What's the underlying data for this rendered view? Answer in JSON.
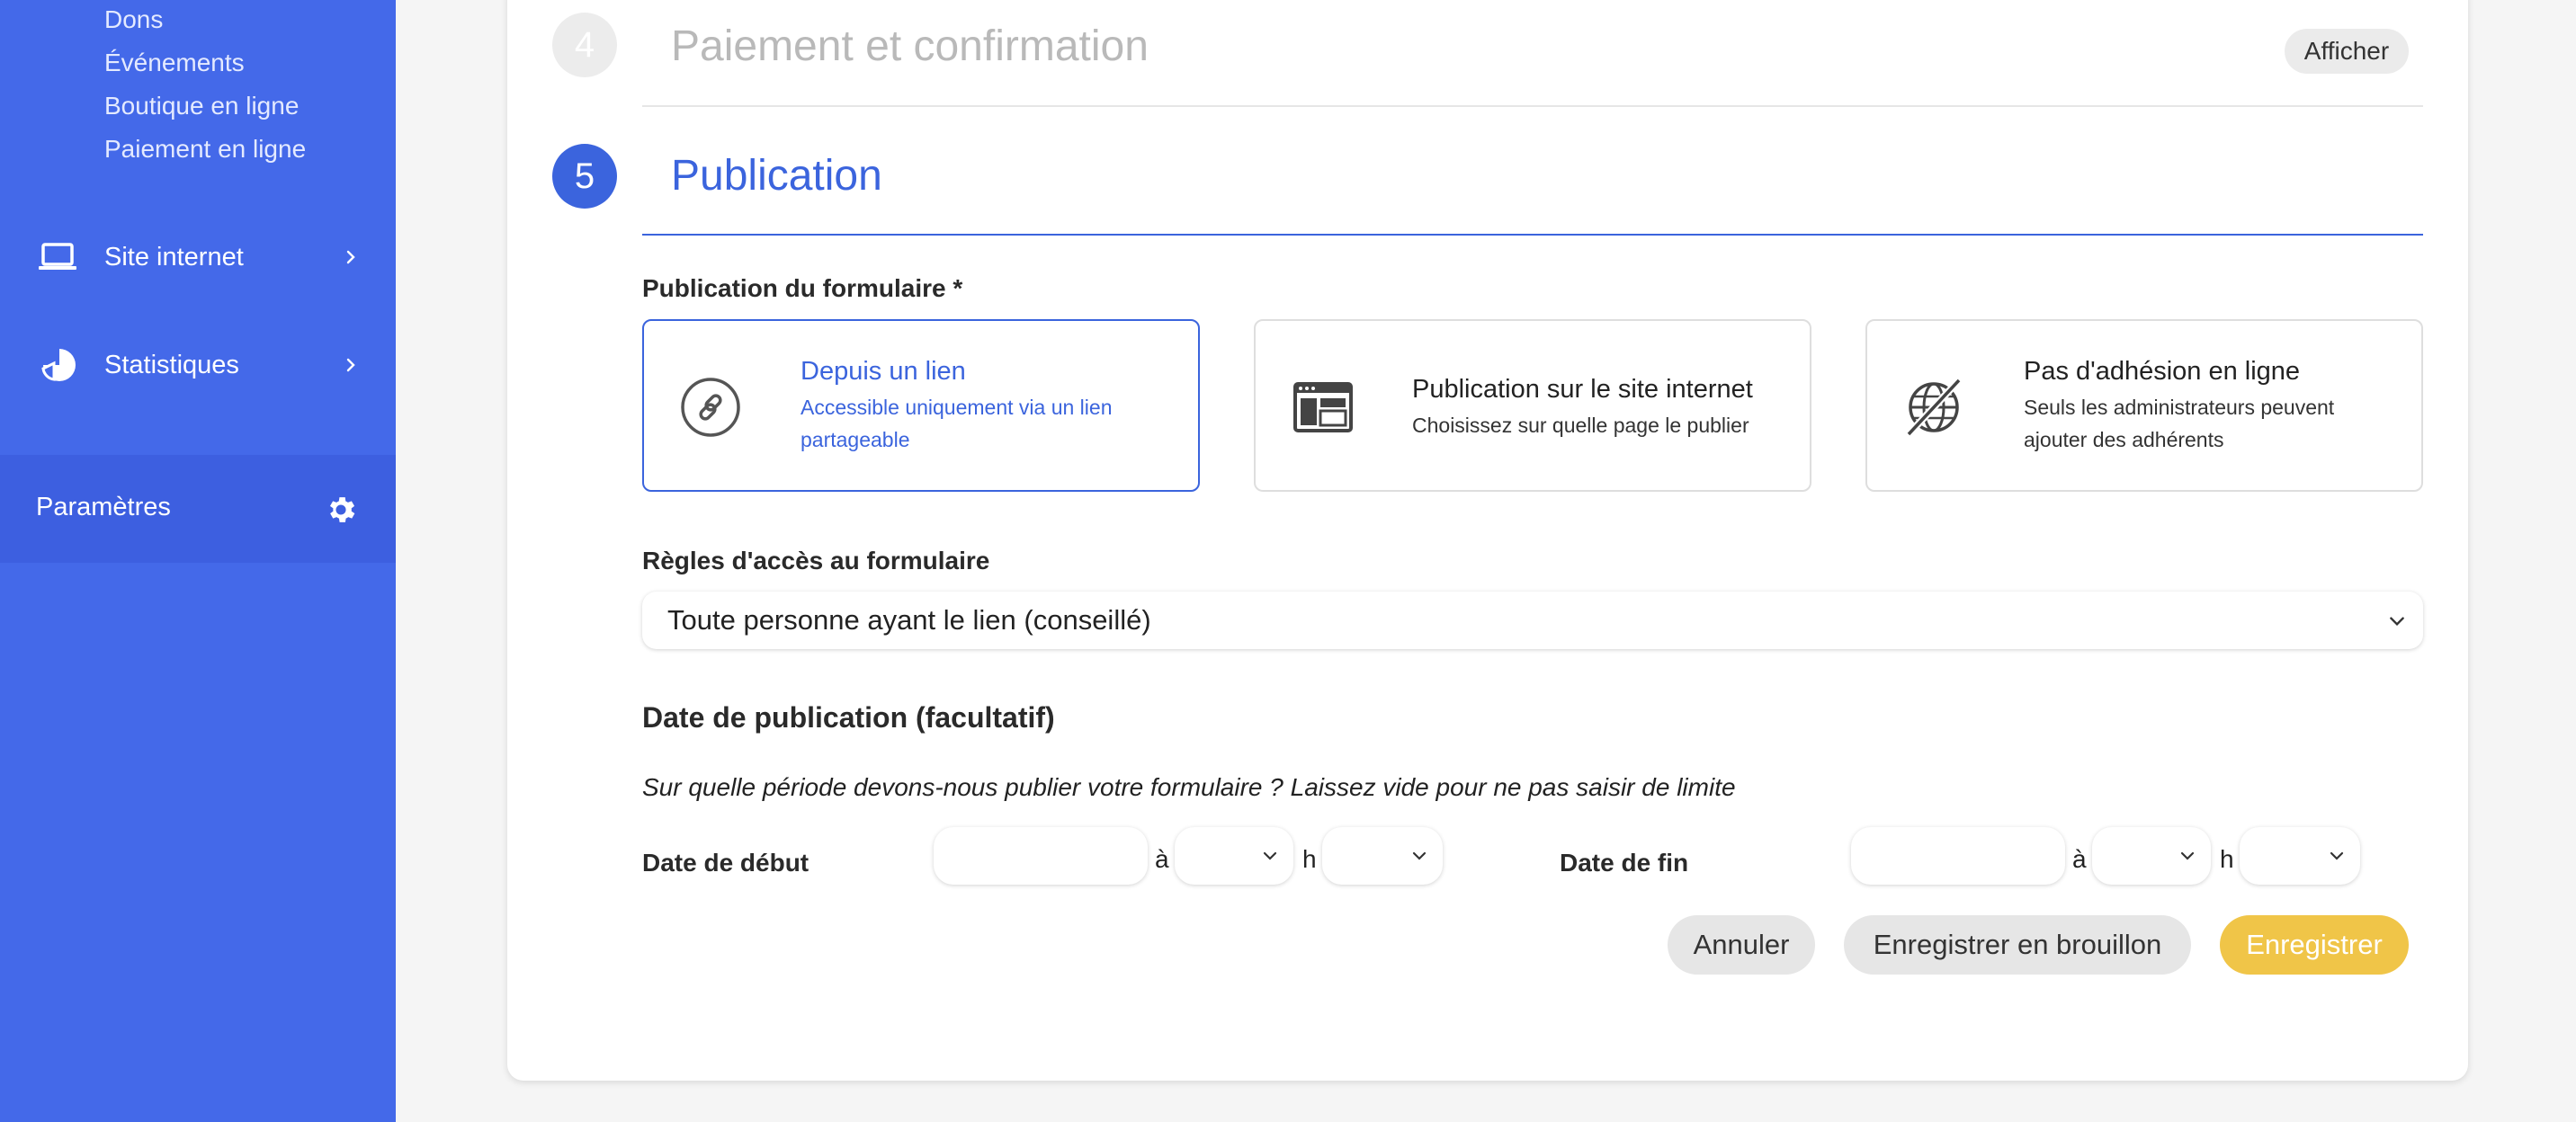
{
  "sidebar": {
    "sub_items": [
      "Dons",
      "Événements",
      "Boutique en ligne",
      "Paiement en ligne"
    ],
    "nav": [
      {
        "label": "Site internet",
        "icon": "laptop-icon"
      },
      {
        "label": "Statistiques",
        "icon": "pie-chart-icon"
      }
    ],
    "settings": {
      "label": "Paramètres",
      "icon": "gear-icon"
    }
  },
  "steps": {
    "step4": {
      "number": "4",
      "title": "Paiement et confirmation",
      "button": "Afficher"
    },
    "step5": {
      "number": "5",
      "title": "Publication"
    }
  },
  "publication": {
    "label": "Publication du formulaire *",
    "options": [
      {
        "title": "Depuis un lien",
        "desc": "Accessible uniquement via un lien partageable",
        "icon": "link-icon",
        "selected": true
      },
      {
        "title": "Publication sur le site internet",
        "desc": "Choisissez sur quelle page le publier",
        "icon": "website-layout-icon",
        "selected": false
      },
      {
        "title": "Pas d'adhésion en ligne",
        "desc": "Seuls les administrateurs peuvent ajouter des adhérents",
        "icon": "no-web-icon",
        "selected": false
      }
    ]
  },
  "access": {
    "label": "Règles d'accès au formulaire",
    "value": "Toute personne ayant le lien (conseillé)"
  },
  "date": {
    "title": "Date de publication (facultatif)",
    "hint": "Sur quelle période devons-nous publier votre formulaire ? Laissez vide pour ne pas saisir de limite",
    "start_label": "Date de début",
    "end_label": "Date de fin",
    "at": "à",
    "h": "h"
  },
  "actions": {
    "cancel": "Annuler",
    "draft": "Enregistrer en brouillon",
    "save": "Enregistrer"
  },
  "colors": {
    "sidebar": "#4469e9",
    "accent": "#3b64dd",
    "save": "#f0c548"
  }
}
